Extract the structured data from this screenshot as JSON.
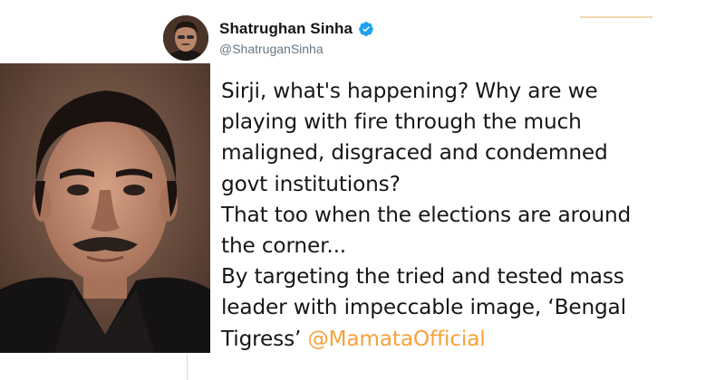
{
  "tweet": {
    "display_name": "Shatrughan Sinha",
    "handle": "@ShatruganSinha",
    "verified": true,
    "lines": [
      "Sirji, what's happening? Why are we",
      "playing with fire through the much",
      "maligned, disgraced and condemned",
      "govt institutions?",
      "That too when the elections are around",
      "the corner...",
      "By targeting the tried and tested mass",
      "leader with impeccable image, ‘Bengal"
    ],
    "last_line_text": "Tigress’ ",
    "mention": "@MamataOfficial"
  },
  "colors": {
    "name": "#14171a",
    "handle": "#657786",
    "verified_badge": "#1da1f2",
    "mention": "#f7a23b",
    "accent_line": "#f2d7b0"
  },
  "icons": {
    "verified": "verified-badge-icon"
  }
}
